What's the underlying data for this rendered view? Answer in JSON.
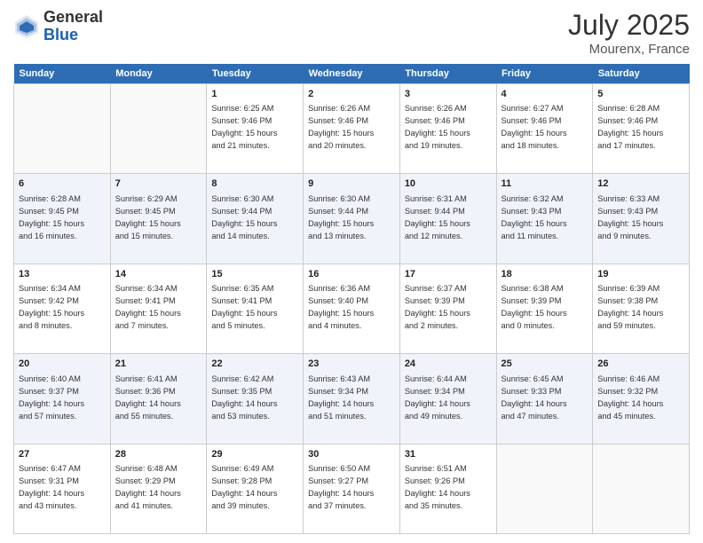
{
  "header": {
    "logo_general": "General",
    "logo_blue": "Blue",
    "month": "July 2025",
    "location": "Mourenx, France"
  },
  "days_of_week": [
    "Sunday",
    "Monday",
    "Tuesday",
    "Wednesday",
    "Thursday",
    "Friday",
    "Saturday"
  ],
  "weeks": [
    [
      {
        "day": "",
        "info": ""
      },
      {
        "day": "",
        "info": ""
      },
      {
        "day": "1",
        "info": "Sunrise: 6:25 AM\nSunset: 9:46 PM\nDaylight: 15 hours\nand 21 minutes."
      },
      {
        "day": "2",
        "info": "Sunrise: 6:26 AM\nSunset: 9:46 PM\nDaylight: 15 hours\nand 20 minutes."
      },
      {
        "day": "3",
        "info": "Sunrise: 6:26 AM\nSunset: 9:46 PM\nDaylight: 15 hours\nand 19 minutes."
      },
      {
        "day": "4",
        "info": "Sunrise: 6:27 AM\nSunset: 9:46 PM\nDaylight: 15 hours\nand 18 minutes."
      },
      {
        "day": "5",
        "info": "Sunrise: 6:28 AM\nSunset: 9:46 PM\nDaylight: 15 hours\nand 17 minutes."
      }
    ],
    [
      {
        "day": "6",
        "info": "Sunrise: 6:28 AM\nSunset: 9:45 PM\nDaylight: 15 hours\nand 16 minutes."
      },
      {
        "day": "7",
        "info": "Sunrise: 6:29 AM\nSunset: 9:45 PM\nDaylight: 15 hours\nand 15 minutes."
      },
      {
        "day": "8",
        "info": "Sunrise: 6:30 AM\nSunset: 9:44 PM\nDaylight: 15 hours\nand 14 minutes."
      },
      {
        "day": "9",
        "info": "Sunrise: 6:30 AM\nSunset: 9:44 PM\nDaylight: 15 hours\nand 13 minutes."
      },
      {
        "day": "10",
        "info": "Sunrise: 6:31 AM\nSunset: 9:44 PM\nDaylight: 15 hours\nand 12 minutes."
      },
      {
        "day": "11",
        "info": "Sunrise: 6:32 AM\nSunset: 9:43 PM\nDaylight: 15 hours\nand 11 minutes."
      },
      {
        "day": "12",
        "info": "Sunrise: 6:33 AM\nSunset: 9:43 PM\nDaylight: 15 hours\nand 9 minutes."
      }
    ],
    [
      {
        "day": "13",
        "info": "Sunrise: 6:34 AM\nSunset: 9:42 PM\nDaylight: 15 hours\nand 8 minutes."
      },
      {
        "day": "14",
        "info": "Sunrise: 6:34 AM\nSunset: 9:41 PM\nDaylight: 15 hours\nand 7 minutes."
      },
      {
        "day": "15",
        "info": "Sunrise: 6:35 AM\nSunset: 9:41 PM\nDaylight: 15 hours\nand 5 minutes."
      },
      {
        "day": "16",
        "info": "Sunrise: 6:36 AM\nSunset: 9:40 PM\nDaylight: 15 hours\nand 4 minutes."
      },
      {
        "day": "17",
        "info": "Sunrise: 6:37 AM\nSunset: 9:39 PM\nDaylight: 15 hours\nand 2 minutes."
      },
      {
        "day": "18",
        "info": "Sunrise: 6:38 AM\nSunset: 9:39 PM\nDaylight: 15 hours\nand 0 minutes."
      },
      {
        "day": "19",
        "info": "Sunrise: 6:39 AM\nSunset: 9:38 PM\nDaylight: 14 hours\nand 59 minutes."
      }
    ],
    [
      {
        "day": "20",
        "info": "Sunrise: 6:40 AM\nSunset: 9:37 PM\nDaylight: 14 hours\nand 57 minutes."
      },
      {
        "day": "21",
        "info": "Sunrise: 6:41 AM\nSunset: 9:36 PM\nDaylight: 14 hours\nand 55 minutes."
      },
      {
        "day": "22",
        "info": "Sunrise: 6:42 AM\nSunset: 9:35 PM\nDaylight: 14 hours\nand 53 minutes."
      },
      {
        "day": "23",
        "info": "Sunrise: 6:43 AM\nSunset: 9:34 PM\nDaylight: 14 hours\nand 51 minutes."
      },
      {
        "day": "24",
        "info": "Sunrise: 6:44 AM\nSunset: 9:34 PM\nDaylight: 14 hours\nand 49 minutes."
      },
      {
        "day": "25",
        "info": "Sunrise: 6:45 AM\nSunset: 9:33 PM\nDaylight: 14 hours\nand 47 minutes."
      },
      {
        "day": "26",
        "info": "Sunrise: 6:46 AM\nSunset: 9:32 PM\nDaylight: 14 hours\nand 45 minutes."
      }
    ],
    [
      {
        "day": "27",
        "info": "Sunrise: 6:47 AM\nSunset: 9:31 PM\nDaylight: 14 hours\nand 43 minutes."
      },
      {
        "day": "28",
        "info": "Sunrise: 6:48 AM\nSunset: 9:29 PM\nDaylight: 14 hours\nand 41 minutes."
      },
      {
        "day": "29",
        "info": "Sunrise: 6:49 AM\nSunset: 9:28 PM\nDaylight: 14 hours\nand 39 minutes."
      },
      {
        "day": "30",
        "info": "Sunrise: 6:50 AM\nSunset: 9:27 PM\nDaylight: 14 hours\nand 37 minutes."
      },
      {
        "day": "31",
        "info": "Sunrise: 6:51 AM\nSunset: 9:26 PM\nDaylight: 14 hours\nand 35 minutes."
      },
      {
        "day": "",
        "info": ""
      },
      {
        "day": "",
        "info": ""
      }
    ]
  ]
}
